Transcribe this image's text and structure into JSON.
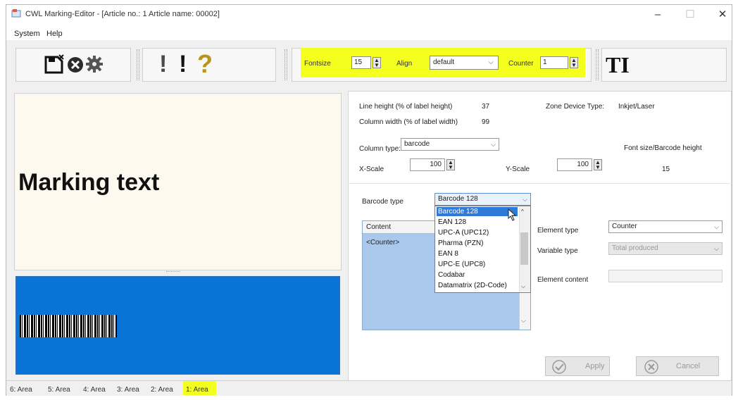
{
  "window": {
    "title": "CWL Marking-Editor - [Article no.: 1   Article name: 00002]",
    "minimize": "–",
    "maximize": "☐",
    "close": "✕"
  },
  "menu": {
    "system": "System",
    "help": "Help"
  },
  "toolbar": {
    "fontsize_label": "Fontsize",
    "fontsize_value": "15",
    "align_label": "Align",
    "align_value": "default",
    "counter_label": "Counter",
    "counter_value": "1",
    "text_tool": "TI",
    "excl1": "!",
    "excl2": "!",
    "question": "?",
    "highlight_color": "#f5ff1d"
  },
  "preview": {
    "marking_text": "Marking text",
    "barcode_bg": "#0a73d6"
  },
  "properties": {
    "line_height_label": "Line height (% of label height)",
    "line_height_value": "37",
    "zone_device_label": "Zone Device Type:",
    "zone_device_value": "Inkjet/Laser",
    "column_width_label": "Column width (% of label width)",
    "column_width_value": "99",
    "column_type_label": "Column type:",
    "column_type_value": "barcode",
    "font_size_label": "Font size/Barcode height",
    "font_size_value": "15",
    "xscale_label": "X-Scale",
    "xscale_value": "100",
    "yscale_label": "Y-Scale",
    "yscale_value": "100"
  },
  "barcode": {
    "type_label": "Barcode type",
    "type_value": "Barcode 128",
    "options": [
      "Barcode 128",
      "EAN 128",
      "UPC-A (UPC12)",
      "Pharma (PZN)",
      "EAN 8",
      "UPC-E (UPC8)",
      "Codabar",
      "Datamatrix (2D-Code)"
    ]
  },
  "content": {
    "header": "Content",
    "row1": "<Counter>"
  },
  "element": {
    "type_label": "Element type",
    "type_value": "Counter",
    "variable_label": "Variable type",
    "variable_value": "Total produced",
    "content_label": "Element content",
    "content_value": ""
  },
  "buttons": {
    "apply": "Apply",
    "cancel": "Cancel"
  },
  "areas": [
    "6: Area",
    "5: Area",
    "4: Area",
    "3: Area",
    "2: Area",
    "1: Area"
  ]
}
